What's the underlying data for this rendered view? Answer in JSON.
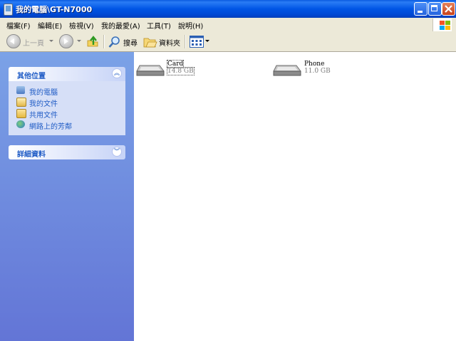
{
  "window": {
    "title": "我的電腦\\GT-N7000"
  },
  "menu": {
    "items": [
      {
        "label": "檔案(F)"
      },
      {
        "label": "編輯(E)"
      },
      {
        "label": "檢視(V)"
      },
      {
        "label": "我的最愛(A)"
      },
      {
        "label": "工具(T)"
      },
      {
        "label": "說明(H)"
      }
    ]
  },
  "toolbar": {
    "back_label": "上一頁",
    "search_label": "搜尋",
    "folders_label": "資料夾"
  },
  "taskpane": {
    "other_places": {
      "title": "其他位置",
      "items": [
        {
          "label": "我的電腦",
          "icon": "computer-icon"
        },
        {
          "label": "我的文件",
          "icon": "documents-icon"
        },
        {
          "label": "共用文件",
          "icon": "shared-folder-icon"
        },
        {
          "label": "網路上的芳鄰",
          "icon": "network-icon"
        }
      ]
    },
    "details": {
      "title": "詳細資料"
    }
  },
  "drives": [
    {
      "name": "Card",
      "size": "14.8 GB"
    },
    {
      "name": "Phone",
      "size": "11.0 GB"
    }
  ],
  "colors": {
    "titlebar": "#0055e5",
    "taskpane_top": "#7ba2e7",
    "taskpane_bottom": "#6375d6",
    "link": "#215dc6"
  }
}
